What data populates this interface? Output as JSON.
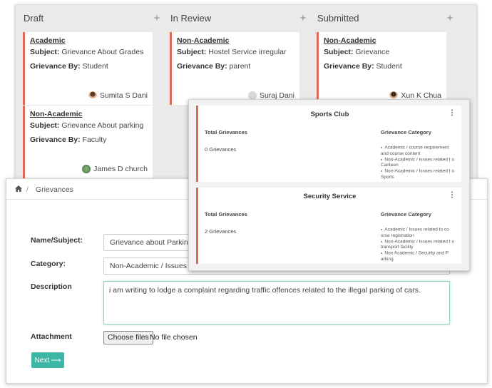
{
  "board": {
    "columns": [
      {
        "title": "Draft"
      },
      {
        "title": "In Review"
      },
      {
        "title": "Submitted"
      }
    ],
    "add_icon": "plus-icon",
    "subject_label": "Subject:",
    "by_label": "Grievance By:",
    "cards": [
      {
        "type": "Academic",
        "subject": "Grievance About Grades",
        "by": "Student",
        "owner": "Sumita S Dani"
      },
      {
        "type": "Non-Academic",
        "subject": "Grievance About parking",
        "by": "Faculty",
        "owner": "James D church"
      },
      {
        "type": "Non-Academic",
        "subject": "Hostel Service irregular",
        "by": "parent",
        "owner": "Suraj Dani"
      },
      {
        "type": "Non-Academic",
        "subject": "Grievance",
        "by": "Student",
        "owner": "Xun K Chua"
      }
    ]
  },
  "breadcrumb": {
    "home_icon": "home-icon",
    "separator": "/",
    "current": "Grievances"
  },
  "form": {
    "name_label": "Name/Subject:",
    "name_value": "Grievance about Parking",
    "category_label": "Category:",
    "category_value": "Non-Academic / Issues re",
    "description_label": "Description",
    "description_value": "i am writing to lodge a complaint regarding traffic offences related to the illegal parking of cars.",
    "attachment_label": "Attachment",
    "file_button": "Choose files",
    "file_status": "No file chosen",
    "next_label": "Next",
    "next_icon": "arrow-right-icon"
  },
  "popup": {
    "total_header": "Total Grievances",
    "category_header": "Grievance Category",
    "menu_icon": "kebab-menu-icon",
    "cards": [
      {
        "title": "Sports Club",
        "count": "0 Grievances",
        "categories": [
          "Academic / course requirement and course content",
          "Non-Academic / Issues related t o Canteen",
          "Non-Academic / Issues related t o Sports"
        ]
      },
      {
        "title": "Security Service",
        "count": "2 Grievances",
        "categories": [
          "Academic / Issues related to co urse registration",
          "Non-Academic / Issues related t o transport facility",
          "Non Academic / Security and P arking"
        ]
      }
    ]
  },
  "colors": {
    "accent_teal": "#3fb6a5",
    "card_border_red": "#e06a5a",
    "board_bg": "#eaeaea"
  }
}
